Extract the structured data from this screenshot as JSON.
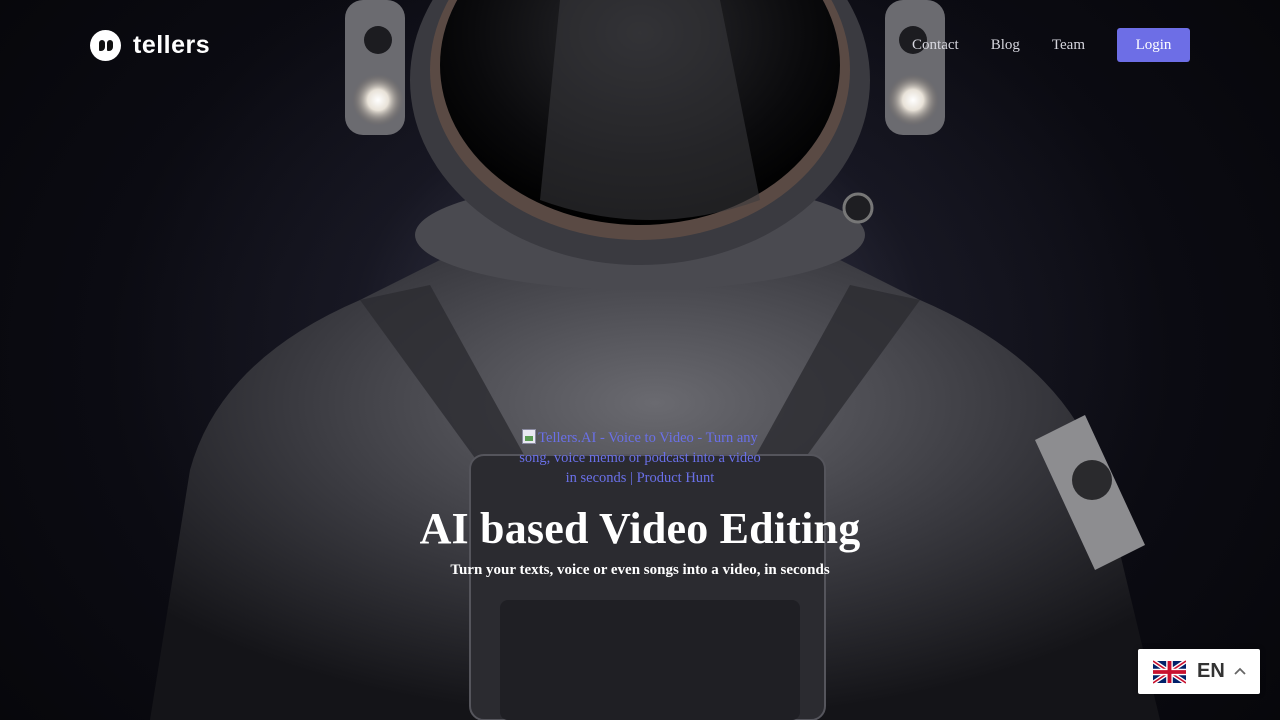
{
  "brand": {
    "name": "tellers",
    "logo_icon": "quote-mark-logo-icon"
  },
  "nav": {
    "links": [
      "Contact",
      "Blog",
      "Team"
    ],
    "login_label": "Login",
    "login_color": "#6d6ee6"
  },
  "hero": {
    "badge_alt": "Tellers.AI - Voice to Video - Turn any song, voice memo or podcast into a video in seconds | Product Hunt",
    "title": "AI based Video Editing",
    "subtitle": "Turn your texts, voice or even songs into a video, in seconds"
  },
  "language": {
    "code": "EN",
    "flag_icon": "uk-flag-icon",
    "chevron_icon": "chevron-up-icon"
  }
}
